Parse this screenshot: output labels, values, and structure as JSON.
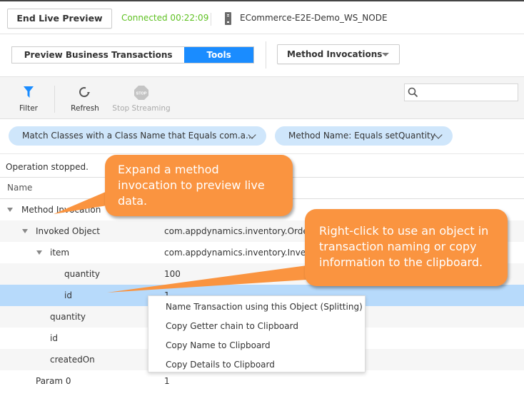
{
  "header": {
    "end_preview_label": "End Live Preview",
    "connection_status": "Connected 00:22:09",
    "node_name": "ECommerce-E2E-Demo_WS_NODE",
    "status_color": "#5ec121"
  },
  "tabs": {
    "items": [
      {
        "label": "Preview Business Transactions",
        "active": false
      },
      {
        "label": "Tools",
        "active": true
      }
    ],
    "active_color": "#1a8cff"
  },
  "tool_selector": {
    "selected": "Method Invocations"
  },
  "toolbar": {
    "filter_label": "Filter",
    "refresh_label": "Refresh",
    "stop_label": "Stop Streaming",
    "stop_icon_text": "STOP",
    "search_placeholder": "",
    "search_value": ""
  },
  "filters": [
    {
      "label": "Match Classes with a Class Name that Equals com.a..."
    },
    {
      "label": "Method Name: Equals setQuantity"
    }
  ],
  "status_text": "Operation stopped.",
  "table": {
    "header": "Name",
    "rows": [
      {
        "name": "Method Invocation",
        "value": "",
        "level": 0,
        "expanded": true
      },
      {
        "name": "Invoked Object",
        "value": "com.appdynamics.inventory.Order(",
        "level": 1,
        "expanded": true
      },
      {
        "name": "item",
        "value": "com.appdynamics.inventory.Invent",
        "level": 2,
        "expanded": true
      },
      {
        "name": "quantity",
        "value": "100",
        "level": 3
      },
      {
        "name": "id",
        "value": "1",
        "level": 3,
        "selected": true
      },
      {
        "name": "quantity",
        "value": "",
        "level": 2
      },
      {
        "name": "id",
        "value": "",
        "level": 2
      },
      {
        "name": "createdOn",
        "value": "",
        "level": 2
      },
      {
        "name": "Param 0",
        "value": "1",
        "level": 1
      }
    ]
  },
  "context_menu": {
    "items": [
      "Name Transaction using this Object (Splitting)",
      "Copy Getter chain to Clipboard",
      "Copy Name to Clipboard",
      "Copy Details to Clipboard"
    ]
  },
  "callouts": {
    "expand": "Expand a method invocation to preview live data.",
    "right_click": "Right-click to use an object in transaction naming or copy information to the clipboard.",
    "color": "#fa9440"
  }
}
